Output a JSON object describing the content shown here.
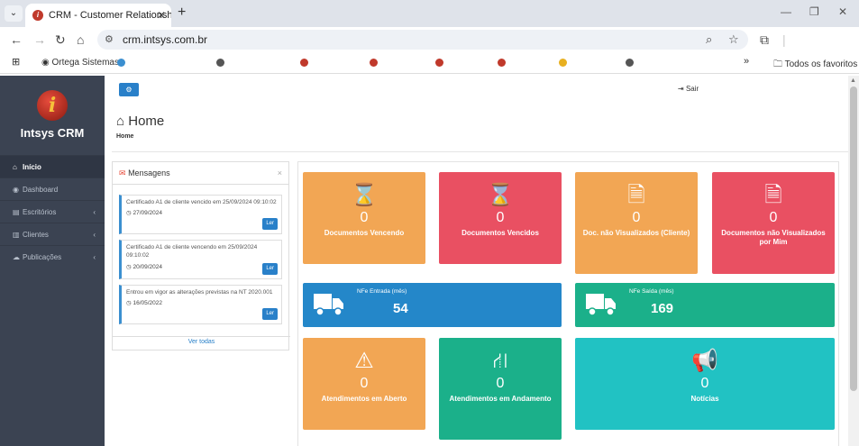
{
  "browser": {
    "tab_title": "CRM - Customer Relationship M",
    "url": "crm.intsys.com.br",
    "bookmarks": [
      "Ortega Sistemas"
    ],
    "all_bookmarks": "Todos os favoritos"
  },
  "sidebar": {
    "brand": "Intsys CRM",
    "items": [
      {
        "label": "Início",
        "icon": "home-icon",
        "active": true
      },
      {
        "label": "Dashboard",
        "icon": "dashboard-icon"
      },
      {
        "label": "Escritórios",
        "icon": "building-icon",
        "chevron": "‹"
      },
      {
        "label": "Clientes",
        "icon": "clients-icon",
        "chevron": "‹"
      },
      {
        "label": "Publicações",
        "icon": "cloud-icon",
        "chevron": "‹"
      }
    ]
  },
  "header": {
    "sair": "Sair",
    "page_title": "Home",
    "breadcrumb": "Home"
  },
  "messages": {
    "title": "Mensagens",
    "close": "×",
    "read_label": "Ler",
    "see_all": "Ver todas",
    "items": [
      {
        "text": "Certificado A1 de cliente vencido em 25/09/2024 09:10:02",
        "date": "27/09/2024"
      },
      {
        "text": "Certificado A1 de cliente vencendo em 25/09/2024 09:10:02",
        "date": "20/09/2024"
      },
      {
        "text": "Entrou em vigor as alterações previstas na NT 2020.001",
        "date": "16/05/2022"
      }
    ]
  },
  "cards": {
    "docs_vencendo": {
      "value": "0",
      "label": "Documentos Vencendo",
      "icon": "hourglass-icon",
      "color": "#f2a654"
    },
    "docs_vencidos": {
      "value": "0",
      "label": "Documentos Vencidos",
      "icon": "hourglass-icon",
      "color": "#e95062"
    },
    "doc_nao_vis_cliente": {
      "value": "0",
      "label": "Doc. não Visualizados (Cliente)",
      "icon": "document-icon",
      "color": "#f2a654"
    },
    "docs_nao_vis_mim": {
      "value": "0",
      "label": "Documentos não Visualizados por Mim",
      "icon": "document-icon",
      "color": "#e95062"
    },
    "nfe_entrada": {
      "value": "54",
      "label": "NFe Entrada (mês)",
      "icon": "truck-icon",
      "color": "#2487c9"
    },
    "nfe_saida": {
      "value": "169",
      "label": "NFe Saída (mês)",
      "icon": "truck-icon",
      "color": "#1bb08a"
    },
    "atend_aberto": {
      "value": "0",
      "label": "Atendimentos em Aberto",
      "icon": "warning-icon",
      "color": "#f2a654"
    },
    "atend_andamento": {
      "value": "0",
      "label": "Atendimentos em Andamento",
      "icon": "road-icon",
      "color": "#1bb08a"
    },
    "noticias": {
      "value": "0",
      "label": "Notícias",
      "icon": "megaphone-icon",
      "color": "#21c2c3"
    }
  }
}
